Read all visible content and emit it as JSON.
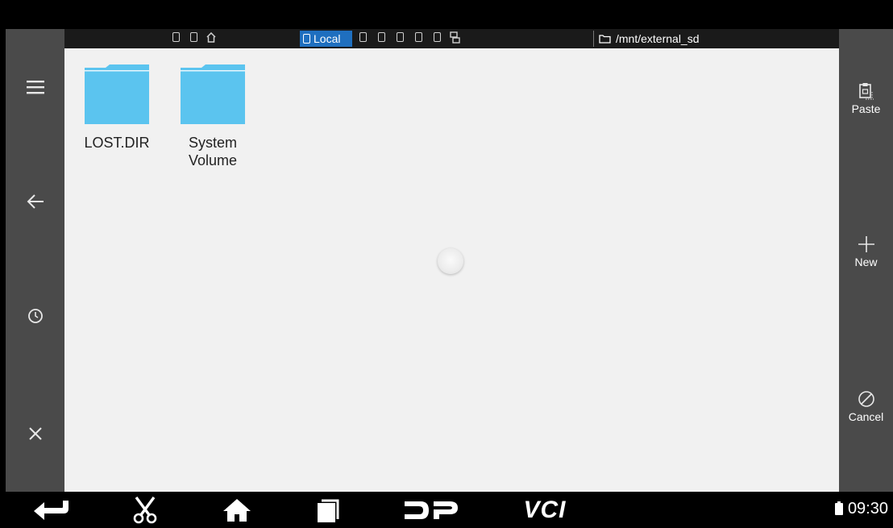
{
  "topbar": {
    "local_tab_label": "Local",
    "path": "/mnt/external_sd"
  },
  "files": [
    {
      "name": "LOST.DIR",
      "icon": "folder-icon"
    },
    {
      "name": "System Volume",
      "icon": "folder-icon"
    }
  ],
  "left_rail": [
    {
      "icon": "menu-icon"
    },
    {
      "icon": "back-arrow-icon"
    },
    {
      "icon": "history-clock-icon"
    },
    {
      "icon": "close-icon"
    }
  ],
  "right_rail": {
    "paste_label": "Paste",
    "new_label": "New",
    "cancel_label": "Cancel"
  },
  "navbar": {
    "vci_label": "VCI",
    "time": "09:30"
  },
  "colors": {
    "rail": "#4a4a4a",
    "topbar": "#1a1a1a",
    "active_tab": "#1f6fbf",
    "folder": "#5bc4ef",
    "content_bg": "#f1f1f1"
  }
}
